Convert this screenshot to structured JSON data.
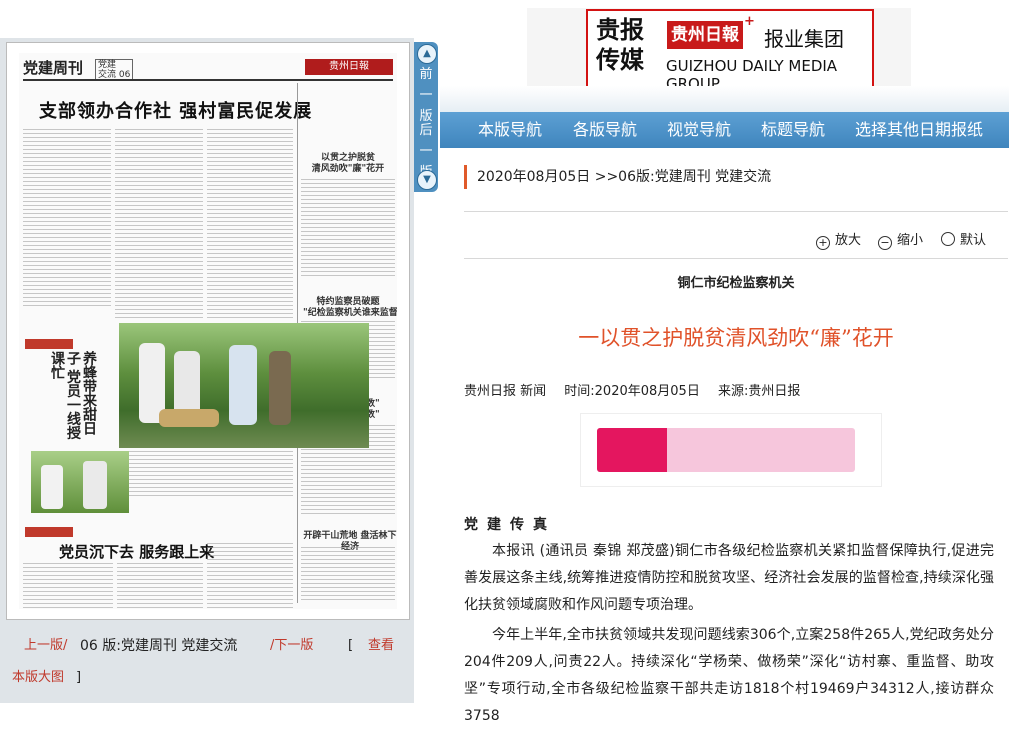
{
  "logo": {
    "part1": "贵报\n传媒",
    "part2": "贵州日報",
    "part3": "报业集团",
    "part4": "GUIZHOU DAILY MEDIA GROUP",
    "plus": "+"
  },
  "top_nav": [
    "本版导航",
    "各版导航",
    "视觉导航",
    "标题导航",
    "选择其他日期报纸"
  ],
  "side_tab": {
    "prev": "前一版",
    "next": "后一版"
  },
  "breadcrumb": "2020年08月05日  >>06版:党建周刊 党建交流",
  "zoom": {
    "in": "放大",
    "out": "缩小",
    "default": "默认"
  },
  "article": {
    "kicker": "铜仁市纪检监察机关",
    "title": "一以贯之护脱贫清风劲吹“廉”花开",
    "source": "贵州日报 新闻",
    "time": "时间:2020年08月05日",
    "origin": "来源:贵州日报",
    "section": "党建传真",
    "para1": "本报讯  (通讯员  秦锦  郑茂盛)铜仁市各级纪检监察机关紧扣监督保障执行,促进完善发展这条主线,统筹推进疫情防控和脱贫攻坚、经济社会发展的监督检查,持续深化强化扶贫领域腐败和作风问题专项治理。",
    "para2": "今年上半年,全市扶贫领域共发现问题线索306个,立案258件265人,党纪政务处分204件209人,问责22人。持续深化“学杨荣、做杨荣”深化“访村寨、重监督、助攻坚”专项行动,全市各级纪检监察干部共走访1818个村19469户34312人,接访群众3758"
  },
  "paper": {
    "head_title": "党建周刊",
    "head_code": "党建\n交流 06",
    "head_logo": "贵州日報",
    "main_headline": "支部领办合作社 强村富民促发展",
    "vertical_headline": "养蜂带来甜日子 党员一线授课忙",
    "sub_headline": "党员沉下去 服务跟上来",
    "col1": "以贯之护脱贫\n清风劲吹\"廉\"花开",
    "col2": "特约监察员破题\n\"纪检监察机关谁来监督\"",
    "col3": "紧盯\"关键少数\"\n管住\"绝大多数\"",
    "col4": "开辟干山荒地  盘活林下经济"
  },
  "bottom_nav": {
    "prev": "上一版/",
    "current": "06 版:党建周刊 党建交流",
    "next": "/下一版",
    "bracket_open": "[",
    "view": "查看",
    "view2": "本版大图",
    "bracket_close": "]"
  },
  "colors": {
    "accent": "#3f85bd",
    "title": "#e0522a",
    "brand_red": "#c81a1a"
  }
}
